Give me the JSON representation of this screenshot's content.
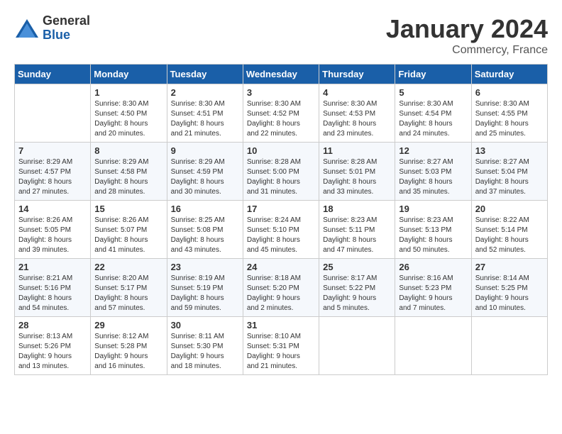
{
  "header": {
    "logo_general": "General",
    "logo_blue": "Blue",
    "title": "January 2024",
    "subtitle": "Commercy, France"
  },
  "days_of_week": [
    "Sunday",
    "Monday",
    "Tuesday",
    "Wednesday",
    "Thursday",
    "Friday",
    "Saturday"
  ],
  "weeks": [
    [
      {
        "day": "",
        "info": ""
      },
      {
        "day": "1",
        "info": "Sunrise: 8:30 AM\nSunset: 4:50 PM\nDaylight: 8 hours\nand 20 minutes."
      },
      {
        "day": "2",
        "info": "Sunrise: 8:30 AM\nSunset: 4:51 PM\nDaylight: 8 hours\nand 21 minutes."
      },
      {
        "day": "3",
        "info": "Sunrise: 8:30 AM\nSunset: 4:52 PM\nDaylight: 8 hours\nand 22 minutes."
      },
      {
        "day": "4",
        "info": "Sunrise: 8:30 AM\nSunset: 4:53 PM\nDaylight: 8 hours\nand 23 minutes."
      },
      {
        "day": "5",
        "info": "Sunrise: 8:30 AM\nSunset: 4:54 PM\nDaylight: 8 hours\nand 24 minutes."
      },
      {
        "day": "6",
        "info": "Sunrise: 8:30 AM\nSunset: 4:55 PM\nDaylight: 8 hours\nand 25 minutes."
      }
    ],
    [
      {
        "day": "7",
        "info": "Sunrise: 8:29 AM\nSunset: 4:57 PM\nDaylight: 8 hours\nand 27 minutes."
      },
      {
        "day": "8",
        "info": "Sunrise: 8:29 AM\nSunset: 4:58 PM\nDaylight: 8 hours\nand 28 minutes."
      },
      {
        "day": "9",
        "info": "Sunrise: 8:29 AM\nSunset: 4:59 PM\nDaylight: 8 hours\nand 30 minutes."
      },
      {
        "day": "10",
        "info": "Sunrise: 8:28 AM\nSunset: 5:00 PM\nDaylight: 8 hours\nand 31 minutes."
      },
      {
        "day": "11",
        "info": "Sunrise: 8:28 AM\nSunset: 5:01 PM\nDaylight: 8 hours\nand 33 minutes."
      },
      {
        "day": "12",
        "info": "Sunrise: 8:27 AM\nSunset: 5:03 PM\nDaylight: 8 hours\nand 35 minutes."
      },
      {
        "day": "13",
        "info": "Sunrise: 8:27 AM\nSunset: 5:04 PM\nDaylight: 8 hours\nand 37 minutes."
      }
    ],
    [
      {
        "day": "14",
        "info": "Sunrise: 8:26 AM\nSunset: 5:05 PM\nDaylight: 8 hours\nand 39 minutes."
      },
      {
        "day": "15",
        "info": "Sunrise: 8:26 AM\nSunset: 5:07 PM\nDaylight: 8 hours\nand 41 minutes."
      },
      {
        "day": "16",
        "info": "Sunrise: 8:25 AM\nSunset: 5:08 PM\nDaylight: 8 hours\nand 43 minutes."
      },
      {
        "day": "17",
        "info": "Sunrise: 8:24 AM\nSunset: 5:10 PM\nDaylight: 8 hours\nand 45 minutes."
      },
      {
        "day": "18",
        "info": "Sunrise: 8:23 AM\nSunset: 5:11 PM\nDaylight: 8 hours\nand 47 minutes."
      },
      {
        "day": "19",
        "info": "Sunrise: 8:23 AM\nSunset: 5:13 PM\nDaylight: 8 hours\nand 50 minutes."
      },
      {
        "day": "20",
        "info": "Sunrise: 8:22 AM\nSunset: 5:14 PM\nDaylight: 8 hours\nand 52 minutes."
      }
    ],
    [
      {
        "day": "21",
        "info": "Sunrise: 8:21 AM\nSunset: 5:16 PM\nDaylight: 8 hours\nand 54 minutes."
      },
      {
        "day": "22",
        "info": "Sunrise: 8:20 AM\nSunset: 5:17 PM\nDaylight: 8 hours\nand 57 minutes."
      },
      {
        "day": "23",
        "info": "Sunrise: 8:19 AM\nSunset: 5:19 PM\nDaylight: 8 hours\nand 59 minutes."
      },
      {
        "day": "24",
        "info": "Sunrise: 8:18 AM\nSunset: 5:20 PM\nDaylight: 9 hours\nand 2 minutes."
      },
      {
        "day": "25",
        "info": "Sunrise: 8:17 AM\nSunset: 5:22 PM\nDaylight: 9 hours\nand 5 minutes."
      },
      {
        "day": "26",
        "info": "Sunrise: 8:16 AM\nSunset: 5:23 PM\nDaylight: 9 hours\nand 7 minutes."
      },
      {
        "day": "27",
        "info": "Sunrise: 8:14 AM\nSunset: 5:25 PM\nDaylight: 9 hours\nand 10 minutes."
      }
    ],
    [
      {
        "day": "28",
        "info": "Sunrise: 8:13 AM\nSunset: 5:26 PM\nDaylight: 9 hours\nand 13 minutes."
      },
      {
        "day": "29",
        "info": "Sunrise: 8:12 AM\nSunset: 5:28 PM\nDaylight: 9 hours\nand 16 minutes."
      },
      {
        "day": "30",
        "info": "Sunrise: 8:11 AM\nSunset: 5:30 PM\nDaylight: 9 hours\nand 18 minutes."
      },
      {
        "day": "31",
        "info": "Sunrise: 8:10 AM\nSunset: 5:31 PM\nDaylight: 9 hours\nand 21 minutes."
      },
      {
        "day": "",
        "info": ""
      },
      {
        "day": "",
        "info": ""
      },
      {
        "day": "",
        "info": ""
      }
    ]
  ]
}
